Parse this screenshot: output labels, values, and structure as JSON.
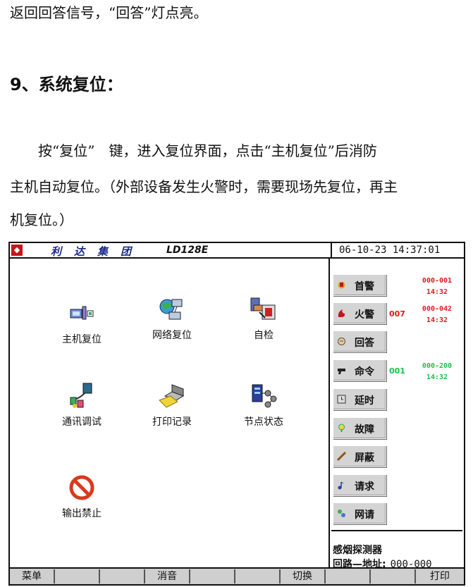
{
  "doc": {
    "line1": "返回回答信号，“回答”灯点亮。",
    "heading": "9、系统复位：",
    "para1": "　　按“复位”　键，进入复位界面，点击“主机复位”后消防",
    "para2": "主机自动复位。（外部设备发生火警时，需要现场先复位，再主",
    "para3": "机复位。）"
  },
  "screen": {
    "company": "利达集团",
    "model": "LD128E",
    "datetime": "06-10-23 14:37:01",
    "functions": [
      {
        "label": "主机复位",
        "icon": "host-reset-icon"
      },
      {
        "label": "网络复位",
        "icon": "network-reset-icon"
      },
      {
        "label": "自检",
        "icon": "self-test-icon"
      },
      {
        "label": "通讯调试",
        "icon": "comm-debug-icon"
      },
      {
        "label": "打印记录",
        "icon": "printer-icon"
      },
      {
        "label": "节点状态",
        "icon": "node-status-icon"
      },
      {
        "label": "输出禁止",
        "icon": "prohibit-icon"
      }
    ],
    "side_buttons": [
      {
        "label": "首警",
        "icon": "first-alarm-icon"
      },
      {
        "label": "火警",
        "icon": "fire-alarm-icon"
      },
      {
        "label": "回答",
        "icon": "answer-icon"
      },
      {
        "label": "命令",
        "icon": "command-icon"
      },
      {
        "label": "延时",
        "icon": "delay-icon"
      },
      {
        "label": "故障",
        "icon": "fault-icon"
      },
      {
        "label": "屏蔽",
        "icon": "shield-icon"
      },
      {
        "label": "请求",
        "icon": "request-icon"
      },
      {
        "label": "网请",
        "icon": "network-request-icon"
      }
    ],
    "counts": {
      "fire": "007",
      "command": "001"
    },
    "events": {
      "first": {
        "addr": "000-001",
        "time": "14:32"
      },
      "fire": {
        "addr": "000-042",
        "time": "14:32"
      },
      "command": {
        "addr": "000-200",
        "time": "14:32"
      }
    },
    "device_type": "感烟探测器",
    "address_label": "回路—地址:",
    "address_value": "000-000",
    "menu": {
      "menu": "菜单",
      "mute": "消音",
      "switch": "切换",
      "print": "打印"
    },
    "colors": {
      "alarm": "#e0191c",
      "command": "#17c24a",
      "company": "#1a2a8a"
    }
  }
}
